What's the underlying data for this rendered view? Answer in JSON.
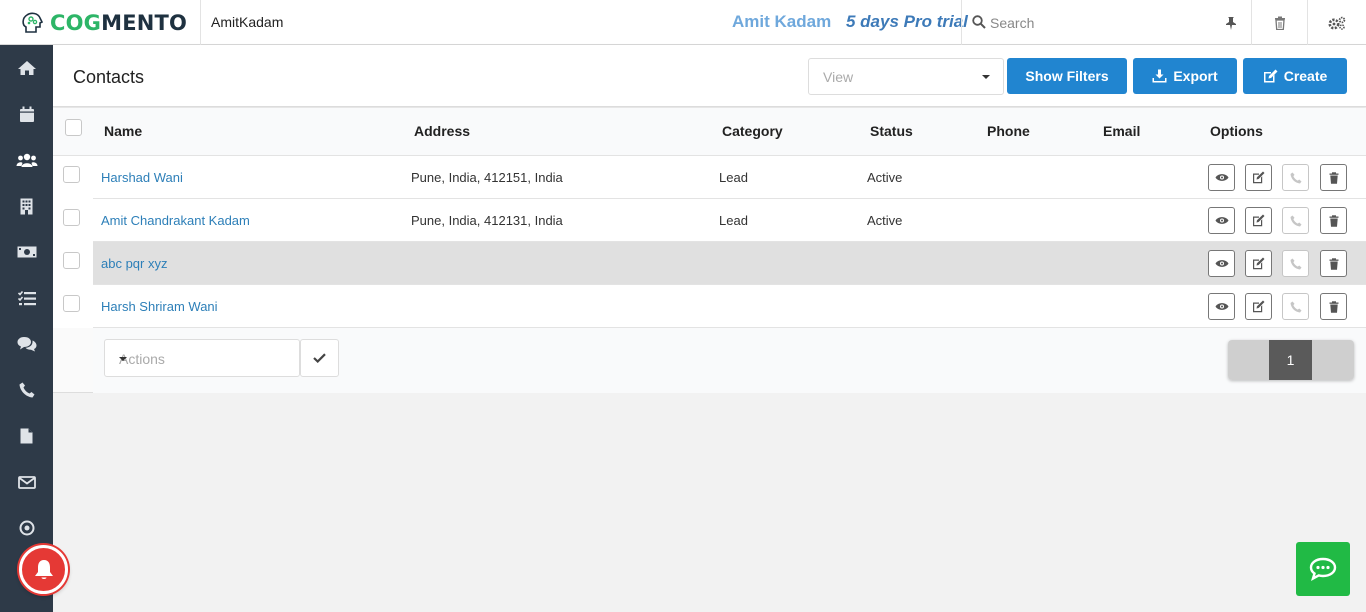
{
  "brand": {
    "logo_part1": "COG",
    "logo_part2": "MENTO"
  },
  "header": {
    "username": "AmitKadam",
    "trial_user": "Amit Kadam",
    "trial_label": "5 days Pro trial",
    "search_placeholder": "Search"
  },
  "sidebar": {
    "items": [
      "home-icon",
      "calendar-icon",
      "contacts-icon",
      "companies-icon",
      "deals-icon",
      "tasks-icon",
      "cases-icon",
      "calls-icon",
      "documents-icon",
      "email-icon",
      "campaigns-icon"
    ]
  },
  "page": {
    "title": "Contacts",
    "view_placeholder": "View",
    "show_filters_label": "Show Filters",
    "export_label": "Export",
    "create_label": "Create"
  },
  "table": {
    "columns": [
      "Name",
      "Address",
      "Category",
      "Status",
      "Phone",
      "Email",
      "Options"
    ],
    "rows": [
      {
        "name": "Harshad Wani",
        "address": "Pune, India, 412151, India",
        "category": "Lead",
        "status": "Active",
        "phone": "",
        "email": ""
      },
      {
        "name": "Amit Chandrakant Kadam",
        "address": "Pune, India, 412131, India",
        "category": "Lead",
        "status": "Active",
        "phone": "",
        "email": ""
      },
      {
        "name": "abc pqr xyz",
        "address": "",
        "category": "",
        "status": "",
        "phone": "",
        "email": ""
      },
      {
        "name": "Harsh Shriram Wani",
        "address": "",
        "category": "",
        "status": "",
        "phone": "",
        "email": ""
      }
    ]
  },
  "footer": {
    "actions_placeholder": "Actions",
    "current_page": "1"
  },
  "colors": {
    "primary": "#2185d0",
    "sidebar": "#2e3a48",
    "brand_green": "#2db567",
    "chat": "#21ba45",
    "bell": "#e53935"
  }
}
